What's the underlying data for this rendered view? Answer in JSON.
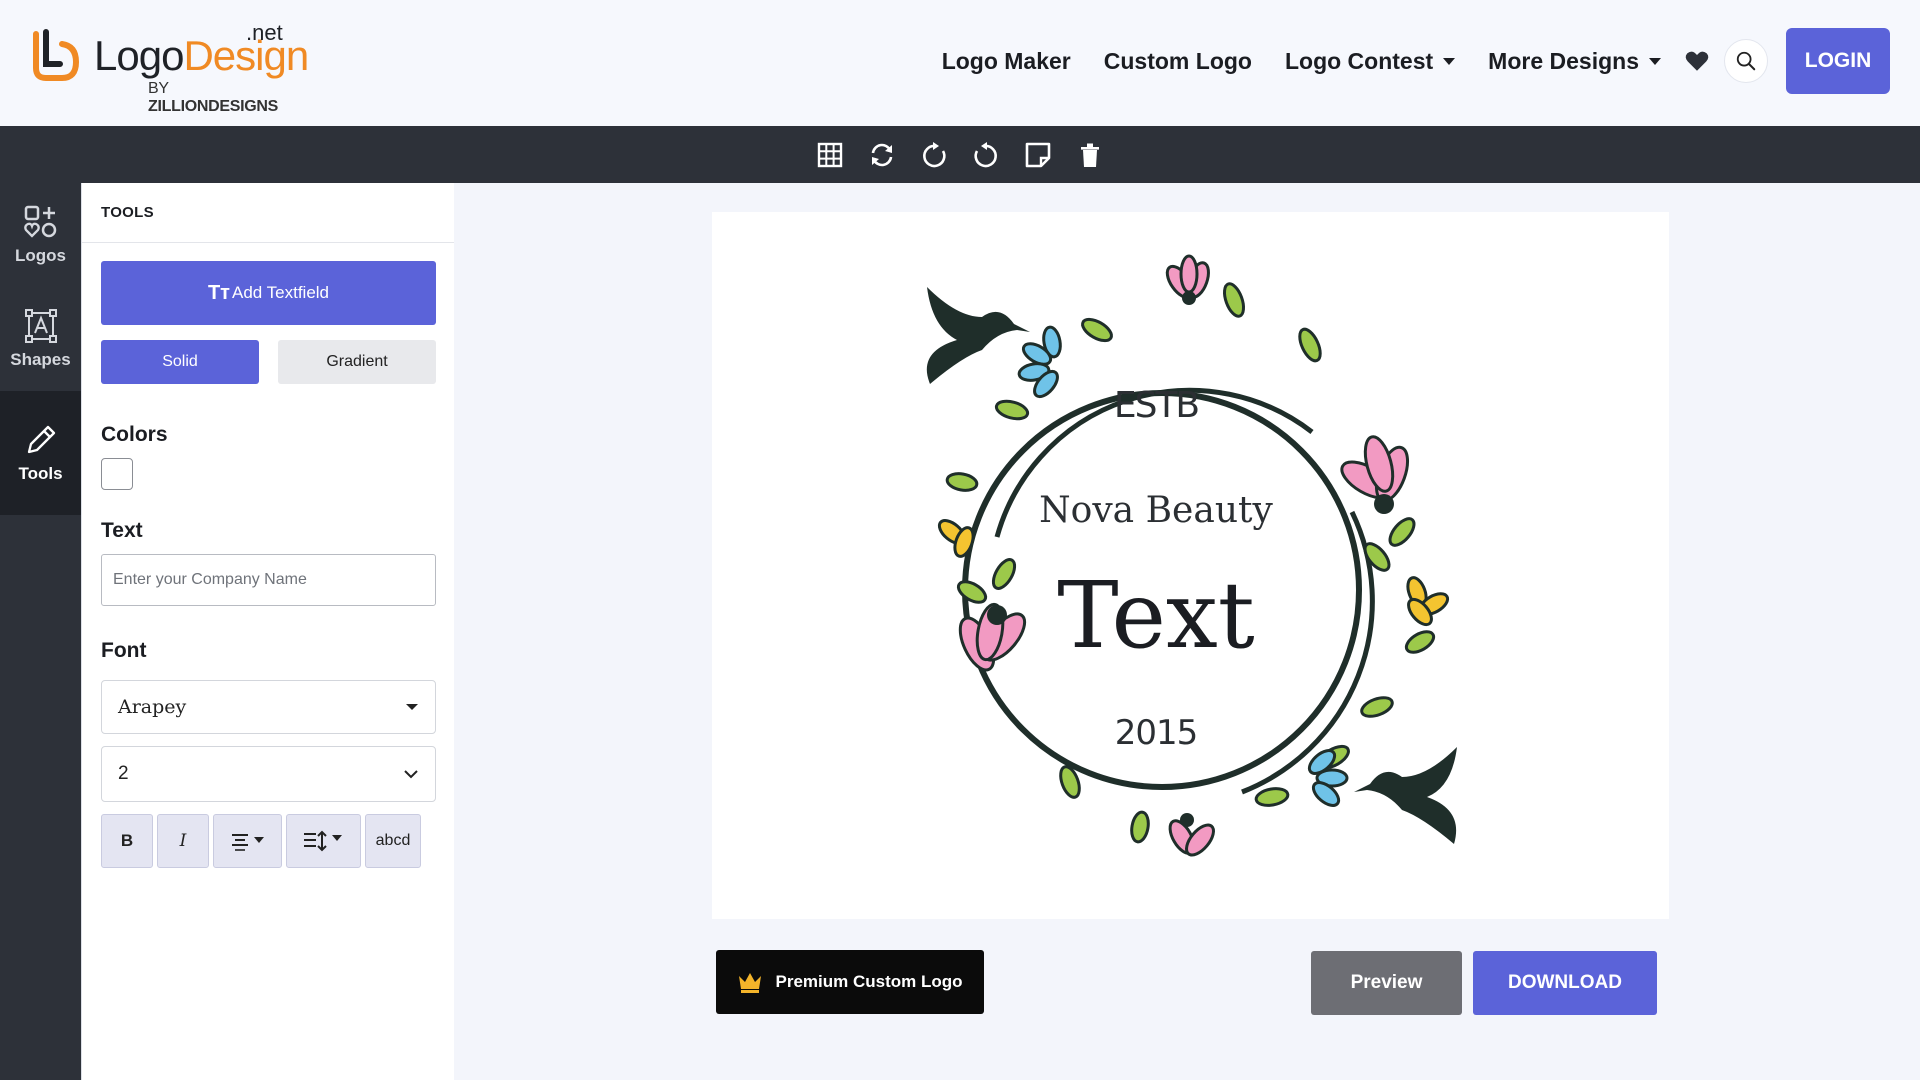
{
  "brand": {
    "word_a": "Logo",
    "word_b": "Design",
    "tld": ".net",
    "by_prefix": "BY",
    "by_name": "ZILLIONDESIGNS"
  },
  "nav": {
    "logo_maker": "Logo Maker",
    "custom_logo": "Custom Logo",
    "logo_contest": "Logo Contest",
    "more_designs": "More Designs",
    "login": "LOGIN"
  },
  "toolbar": {
    "icons": [
      "grid-icon",
      "flip-icon",
      "rotate-right-icon",
      "rotate-left-icon",
      "sticky-note-icon",
      "trash-icon"
    ]
  },
  "rail": {
    "logos": "Logos",
    "shapes": "Shapes",
    "tools": "Tools"
  },
  "panel": {
    "title": "TOOLS",
    "add_textfield": "Add Textfield",
    "add_textfield_glyph": "Tт",
    "solid": "Solid",
    "gradient": "Gradient",
    "colors_label": "Colors",
    "text_label": "Text",
    "text_placeholder": "Enter your Company Name",
    "font_label": "Font",
    "font_value": "Arapey",
    "size_value": "2",
    "bold": "B",
    "italic": "I",
    "case": "abcd"
  },
  "logo_canvas": {
    "estb": "ESTB",
    "company": "Nova Beauty",
    "text": "Text",
    "year": "2015",
    "colors": {
      "ink": "#1f2e2a",
      "pink": "#f29ac2",
      "blue": "#6fc3e8",
      "yellow": "#f4c430",
      "leaf": "#9cc94a"
    }
  },
  "actions": {
    "premium": "Premium Custom Logo",
    "preview": "Preview",
    "download": "DOWNLOAD"
  },
  "colors": {
    "accent": "#5b63d9",
    "dark": "#2d3139"
  }
}
